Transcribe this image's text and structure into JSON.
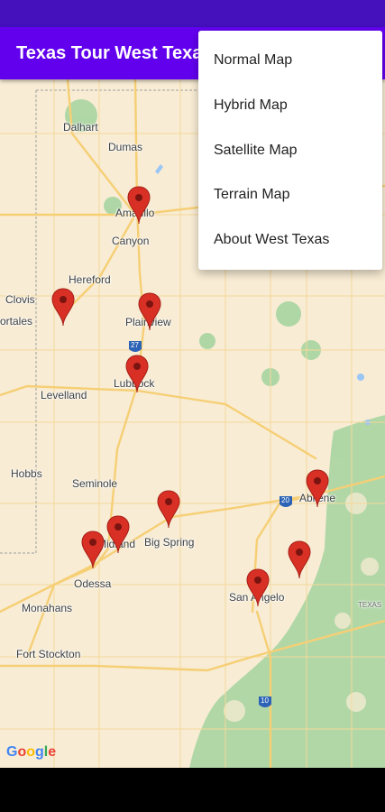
{
  "app_bar": {
    "title": "Texas Tour West Texas"
  },
  "menu": {
    "items": [
      {
        "label": "Normal Map"
      },
      {
        "label": "Hybrid Map"
      },
      {
        "label": "Satellite Map"
      },
      {
        "label": "Terrain Map"
      },
      {
        "label": "About West Texas"
      }
    ]
  },
  "map": {
    "cities": [
      {
        "name": "Dalhart"
      },
      {
        "name": "Dumas"
      },
      {
        "name": "Amarillo"
      },
      {
        "name": "Canyon"
      },
      {
        "name": "Hereford"
      },
      {
        "name": "Clovis"
      },
      {
        "name": "ortales"
      },
      {
        "name": "Plainview"
      },
      {
        "name": "Lubbock"
      },
      {
        "name": "Levelland"
      },
      {
        "name": "Hobbs"
      },
      {
        "name": "Seminole"
      },
      {
        "name": "Big Spring"
      },
      {
        "name": "Midland"
      },
      {
        "name": "Odessa"
      },
      {
        "name": "Abilene"
      },
      {
        "name": "San Angelo"
      },
      {
        "name": "Monahans"
      },
      {
        "name": "Fort Stockton"
      },
      {
        "name": "TEXAS"
      }
    ],
    "shields": [
      {
        "num": "27"
      },
      {
        "num": "20"
      },
      {
        "num": "10"
      }
    ],
    "logo": {
      "text": "Google"
    },
    "colors": {
      "pin": "#d93025",
      "land": "#f8ecd4",
      "road": "#f6cf75",
      "park": "#a8d5a2",
      "water": "#9ac6f5"
    }
  }
}
